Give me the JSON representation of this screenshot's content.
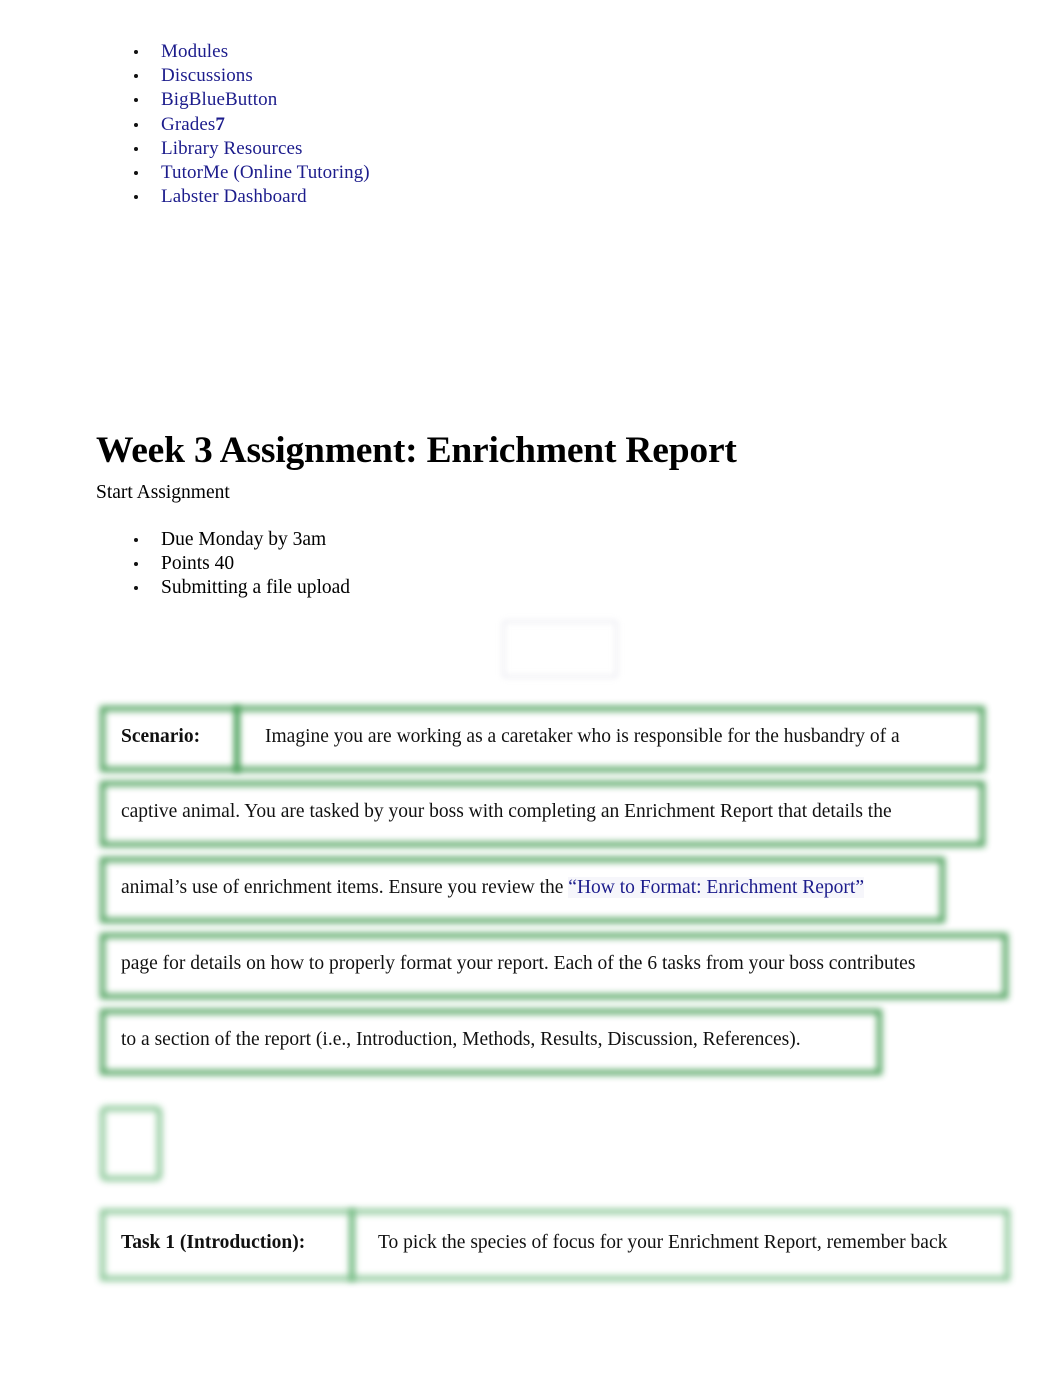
{
  "course_nav": {
    "items": [
      {
        "label": "Modules",
        "badge": ""
      },
      {
        "label": "Discussions",
        "badge": ""
      },
      {
        "label": "BigBlueButton",
        "badge": ""
      },
      {
        "label": "Grades",
        "badge": "7"
      },
      {
        "label": "Library Resources",
        "badge": ""
      },
      {
        "label": "TutorMe (Online Tutoring)",
        "badge": ""
      },
      {
        "label": "Labster Dashboard",
        "badge": ""
      }
    ]
  },
  "assignment": {
    "title": "Week 3 Assignment: Enrichment Report",
    "start_label": "Start Assignment",
    "meta": [
      "Due Monday by 3am",
      "Points 40",
      "Submitting a file upload"
    ]
  },
  "scenario": {
    "label": "Scenario:",
    "lines": [
      {
        "text": "Imagine you are working as a caretaker who is responsible for the husbandry of a"
      },
      {
        "text": "captive animal. You are tasked by your boss with completing an Enrichment Report that details the"
      },
      {
        "pre": "animal’s use of enrichment items. Ensure you review the ",
        "link": "“How to Format: Enrichment Report”",
        "post": ""
      },
      {
        "text": "page for details on how to properly format your report. Each of the 6 tasks from your boss contributes"
      },
      {
        "text": "to a section of the report (i.e., Introduction, Methods, Results, Discussion, References)."
      }
    ]
  },
  "task1": {
    "label": "Task 1 (Introduction):",
    "text": "To pick the species of focus for your Enrichment Report, remember back"
  },
  "colors": {
    "link": "#1c1c8c",
    "border_green": "#3f9a4f",
    "border_green_light": "#7cc08a",
    "text": "#111111"
  }
}
